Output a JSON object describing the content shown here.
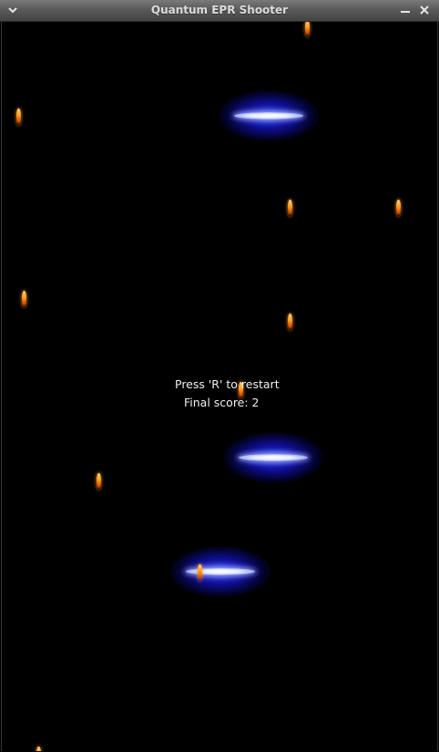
{
  "window": {
    "title": "Quantum EPR Shooter",
    "menu_icon": "chevron-down-icon",
    "minimize_icon": "minimize-icon",
    "close_icon": "close-icon"
  },
  "game": {
    "restart_message": "Press 'R' to restart",
    "final_score_text": "Final score: 2",
    "final_score": 2,
    "state": "game-over",
    "colors": {
      "background": "#000000",
      "enemy_glow": "#2030ff",
      "enemy_core": "#ffffff",
      "bullet": "#ff9a1a"
    },
    "enemies": [
      {
        "name": "enemy-ship-1"
      },
      {
        "name": "enemy-ship-2"
      },
      {
        "name": "enemy-ship-3"
      }
    ],
    "bullets_count": 11
  }
}
